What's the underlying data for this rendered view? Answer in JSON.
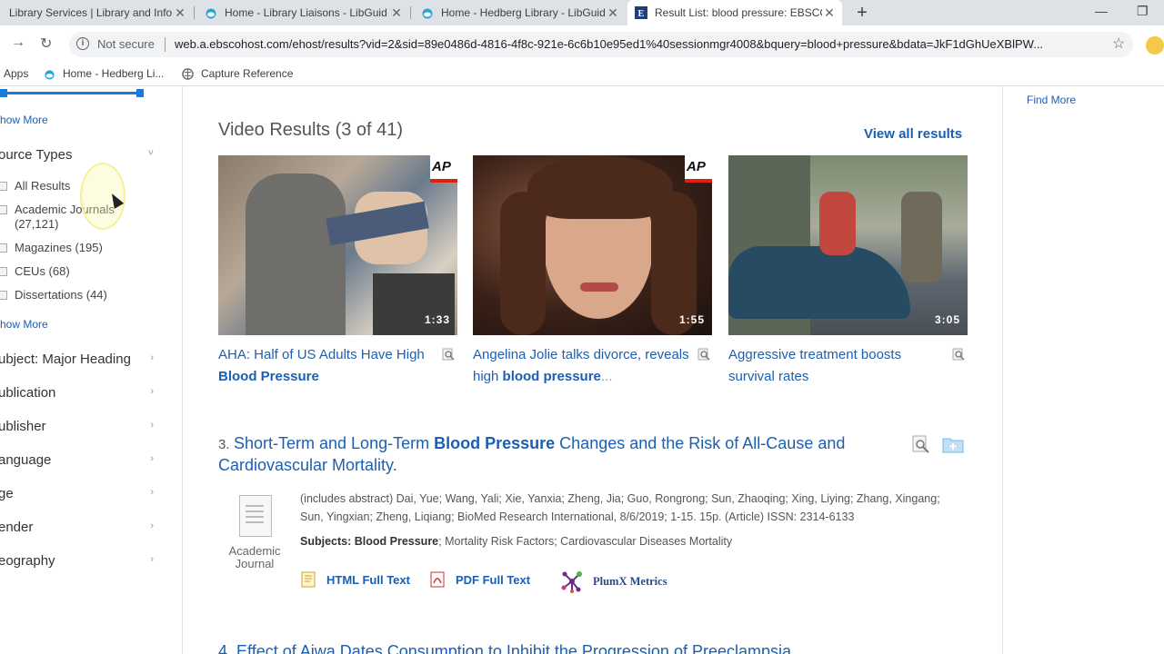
{
  "browser": {
    "tabs": [
      {
        "title": "Library Services | Library and Info",
        "active": false
      },
      {
        "title": "Home - Library Liaisons - LibGuid",
        "active": false
      },
      {
        "title": "Home - Hedberg Library - LibGuid",
        "active": false
      },
      {
        "title": "Result List: blood pressure: EBSCO",
        "active": true
      }
    ],
    "new_tab": "+",
    "security": "Not secure",
    "url": "web.a.ebscohost.com/ehost/results?vid=2&sid=89e0486d-4816-4f8c-921e-6c6b10e95ed1%40sessionmgr4008&bquery=blood+pressure&bdata=JkF1dGhUeXBlPW...",
    "bookmarks": [
      "Apps",
      "Home - Hedberg Li...",
      "Capture Reference"
    ]
  },
  "sidebar": {
    "show_more_1": "how More",
    "source_types": {
      "title": "ource Types",
      "items": [
        {
          "label": "All Results",
          "count": ""
        },
        {
          "label": "Academic Journals",
          "count": "(27,121)"
        },
        {
          "label": "Magazines (195)",
          "count": ""
        },
        {
          "label": "CEUs (68)",
          "count": ""
        },
        {
          "label": "Dissertations (44)",
          "count": ""
        }
      ]
    },
    "show_more_2": "how More",
    "facets": [
      "ubject: Major Heading",
      "ublication",
      "ublisher",
      "anguage",
      "ge",
      "ender",
      "eography"
    ]
  },
  "right": {
    "find_more": "Find More"
  },
  "videos": {
    "heading": "Video Results (3 of 41)",
    "view_all": "View all results",
    "items": [
      {
        "title_pre": "AHA: Half of US Adults Have High",
        "title_bold": "Blood Pressure",
        "title_post": "",
        "duration": "1:33",
        "badge": "AP"
      },
      {
        "title_pre": "Angelina Jolie talks divorce, reveals high",
        "title_bold": "blood pressure",
        "title_post": "...",
        "duration": "1:55",
        "badge": "AP"
      },
      {
        "title_pre": "Aggressive treatment boosts survival rates",
        "title_bold": "",
        "title_post": "",
        "duration": "3:05",
        "badge": ""
      }
    ]
  },
  "result3": {
    "number": "3.",
    "title_pre": "Short-Term and Long-Term",
    "title_bold": "Blood Pressure",
    "title_post": "Changes and the Risk of All-Cause and Cardiovascular Mortality.",
    "doc_type_line1": "Academic",
    "doc_type_line2": "Journal",
    "meta": "(includes abstract) Dai, Yue; Wang, Yali; Xie, Yanxia; Zheng, Jia; Guo, Rongrong; Sun, Zhaoqing; Xing, Liying; Zhang, Xingang; Sun, Yingxian; Zheng, Liqiang; BioMed Research International, 8/6/2019; 1-15. 15p. (Article) ISSN: 2314-6133",
    "subjects_label": "Subjects:",
    "subjects_bold": "Blood Pressure",
    "subjects_rest": "; Mortality Risk Factors; Cardiovascular Diseases Mortality",
    "html_full_text": "HTML Full Text",
    "pdf_full_text": "PDF Full Text",
    "plumx": "PlumX Metrics"
  },
  "result4": {
    "partial_title": "4. Effect of Ajwa Dates Consumption to Inhibit the Progression of Preeclampsia"
  }
}
